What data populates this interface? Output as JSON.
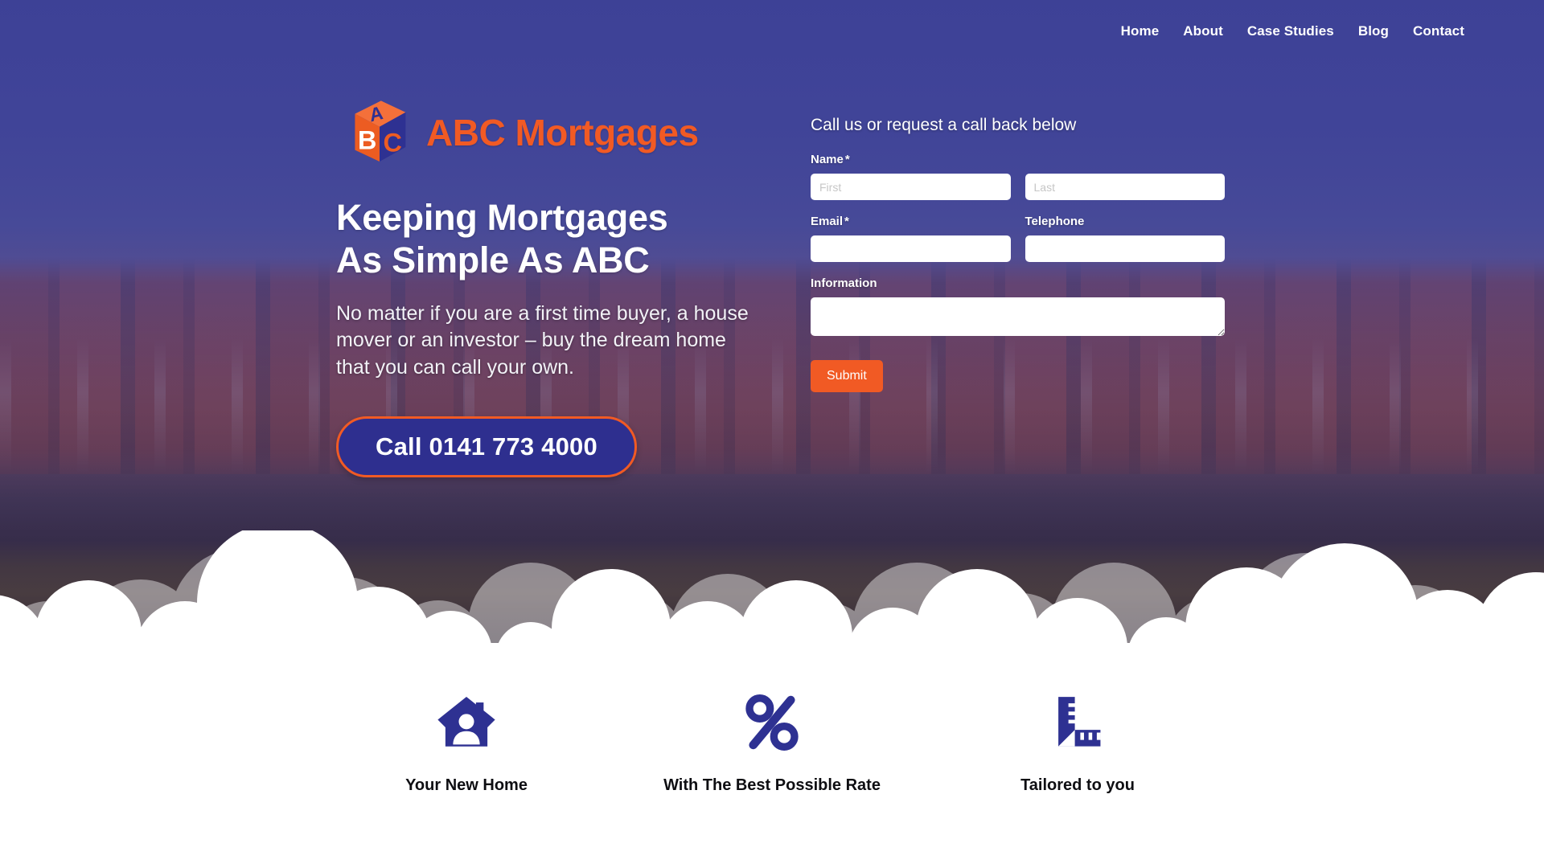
{
  "nav": {
    "items": [
      {
        "label": "Home"
      },
      {
        "label": "About"
      },
      {
        "label": "Case Studies"
      },
      {
        "label": "Blog"
      },
      {
        "label": "Contact"
      }
    ]
  },
  "brand": {
    "name": "ABC Mortgages",
    "cube_letters": {
      "top": "A",
      "left": "B",
      "right": "C"
    }
  },
  "hero": {
    "headline_line1": "Keeping Mortgages",
    "headline_line2": "As Simple As ABC",
    "paragraph": "No matter if you are a first time buyer, a house mover or an investor – buy the dream home that you can call your own.",
    "call_button": "Call 0141 773 4000"
  },
  "form": {
    "title": "Call us or request a call back below",
    "name_label": "Name",
    "name_required": "*",
    "first_placeholder": "First",
    "last_placeholder": "Last",
    "email_label": "Email",
    "email_required": "*",
    "telephone_label": "Telephone",
    "information_label": "Information",
    "first_value": "",
    "last_value": "",
    "email_value": "",
    "telephone_value": "",
    "information_value": "",
    "submit_label": "Submit"
  },
  "features": [
    {
      "icon": "house-person-icon",
      "caption": "Your New Home"
    },
    {
      "icon": "percent-icon",
      "caption": "With The Best Possible Rate"
    },
    {
      "icon": "ruler-square-icon",
      "caption": "Tailored to you"
    }
  ],
  "colors": {
    "brand_orange": "#f15a24",
    "brand_blue": "#2e2f8f",
    "sky_blue": "#454a9a",
    "icon_blue": "#2e3192",
    "white": "#ffffff"
  }
}
